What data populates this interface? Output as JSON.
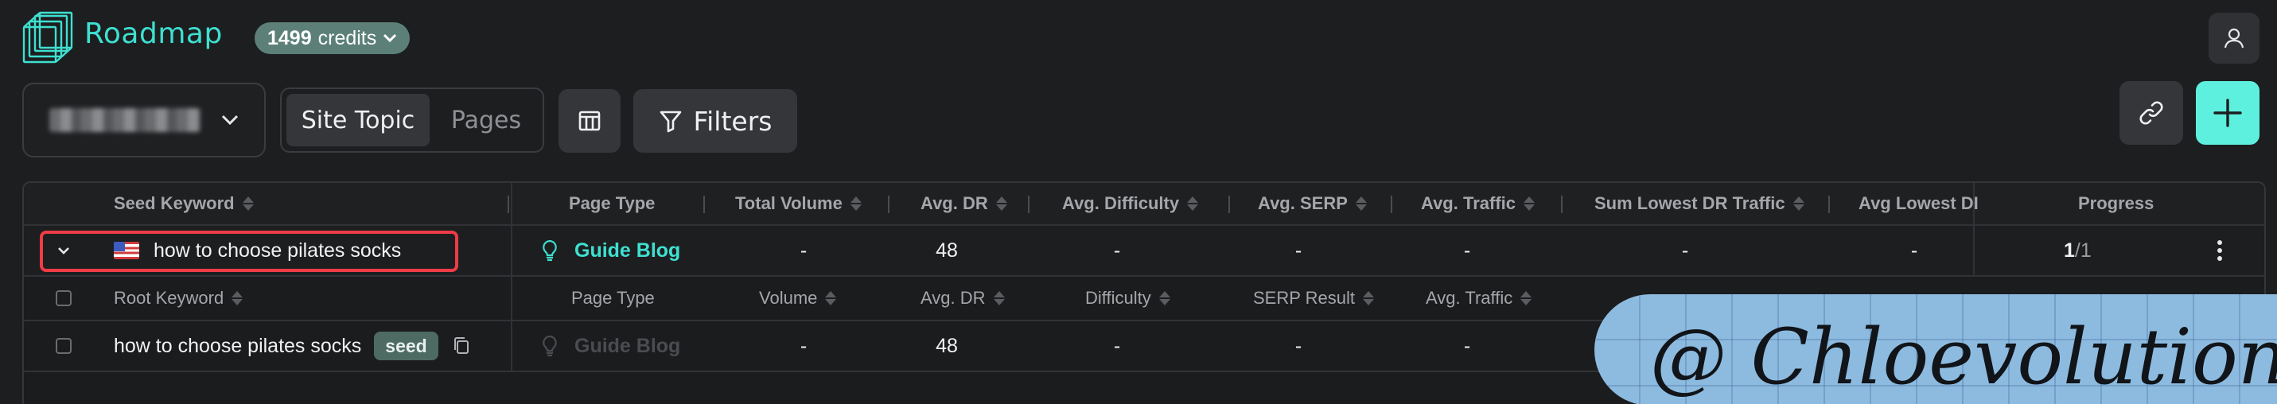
{
  "app": {
    "brand": "Roadmap"
  },
  "credits": {
    "amount": "1499",
    "label": "credits"
  },
  "toolbar": {
    "view_options": [
      "Site Topic",
      "Pages"
    ],
    "active_view": "Site Topic",
    "filters_label": "Filters"
  },
  "table": {
    "columns": [
      "Seed Keyword",
      "Page Type",
      "Total Volume",
      "Avg. DR",
      "Avg. Difficulty",
      "Avg. SERP",
      "Avg. Traffic",
      "Sum Lowest DR Traffic",
      "Avg Lowest DI",
      "Progress"
    ],
    "group_row": {
      "keyword": "how to choose pilates socks",
      "page_type": "Guide Blog",
      "total_volume": "-",
      "avg_dr": "48",
      "avg_difficulty": "-",
      "avg_serp": "-",
      "avg_traffic": "-",
      "sum_lowest_dr_traffic": "-",
      "avg_lowest_di": "-",
      "progress_done": "1",
      "progress_total": "/1"
    },
    "sub_columns": [
      "Root Keyword",
      "Page Type",
      "Volume",
      "Avg. DR",
      "Difficulty",
      "SERP Result",
      "Avg. Traffic"
    ],
    "keyword_row": {
      "keyword": "how to choose pilates socks",
      "badge": "seed",
      "page_type": "Guide Blog",
      "volume": "-",
      "avg_dr": "48",
      "difficulty": "-",
      "serp_result": "-",
      "avg_traffic": "-"
    }
  },
  "watermark": {
    "text": "@ Chloevolution"
  },
  "colors": {
    "accent": "#3ee0d0",
    "add_button": "#5ef0de",
    "highlight": "#ef3c46",
    "credits_bg": "#5c8077"
  }
}
